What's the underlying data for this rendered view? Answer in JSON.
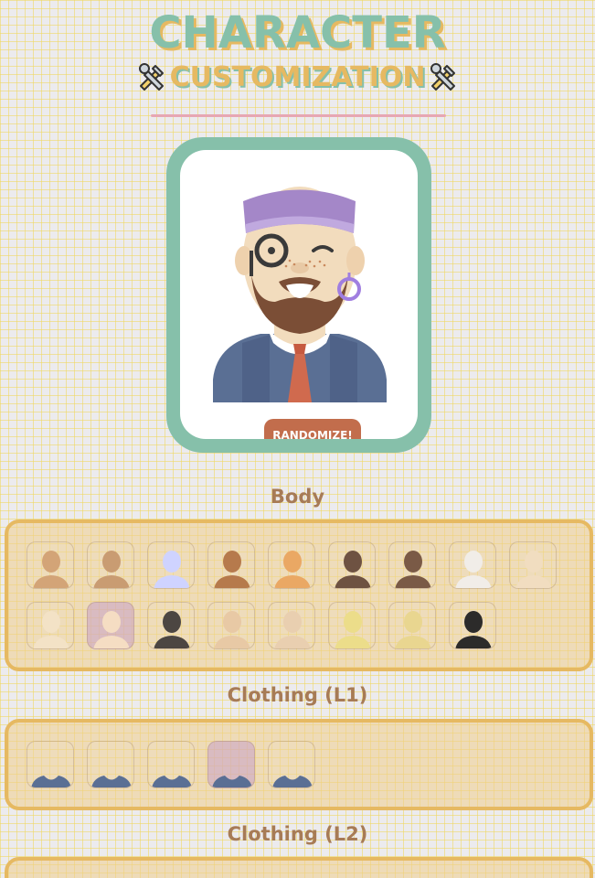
{
  "header": {
    "title": "CHARACTER",
    "subtitle": "CUSTOMIZATION",
    "left_icon": "tools-icon",
    "right_icon": "tools-icon"
  },
  "avatar": {
    "randomize_label": "RANDOMIZE!",
    "colors": {
      "frame": "#86c0aa",
      "button": "#c26d4c"
    }
  },
  "sections": {
    "body": {
      "label": "Body",
      "swatches": [
        {
          "color": "#d3a477",
          "selected": false
        },
        {
          "color": "#c99c72",
          "selected": false
        },
        {
          "color": "#cfd3ff",
          "selected": false
        },
        {
          "color": "#b67a4c",
          "selected": false
        },
        {
          "color": "#eaa864",
          "selected": false
        },
        {
          "color": "#6e5242",
          "selected": false
        },
        {
          "color": "#7a5a46",
          "selected": false
        },
        {
          "color": "#f1ede8",
          "selected": false
        },
        {
          "color": "#f1ddc0",
          "selected": false
        },
        {
          "color": "#f3e2c6",
          "selected": false
        },
        {
          "color": "#f5ddc3",
          "selected": true
        },
        {
          "color": "#4c4642",
          "selected": false
        },
        {
          "color": "#e8c9a5",
          "selected": false
        },
        {
          "color": "#e9cfb0",
          "selected": false
        },
        {
          "color": "#ecdd8a",
          "selected": false
        },
        {
          "color": "#e9d690",
          "selected": false
        },
        {
          "color": "#2c2b2a",
          "selected": false
        }
      ]
    },
    "clothing_l1": {
      "label": "Clothing (L1)",
      "swatches": [
        {
          "color": "#5a6f94",
          "selected": false
        },
        {
          "color": "#5a6f94",
          "selected": false
        },
        {
          "color": "#5a6f94",
          "selected": false
        },
        {
          "color": "#5a6f94",
          "selected": true
        },
        {
          "color": "#5a6f94",
          "selected": false
        }
      ]
    },
    "clothing_l2": {
      "label": "Clothing (L2)"
    }
  }
}
